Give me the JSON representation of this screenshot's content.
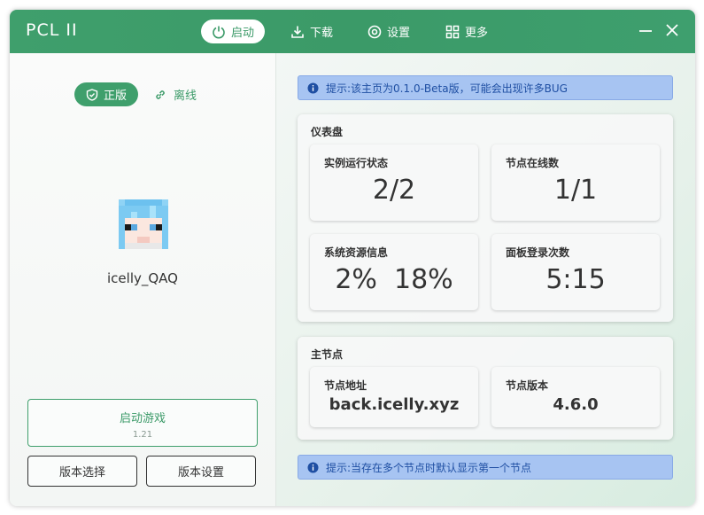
{
  "titlebar": {
    "app_title": "PCL II",
    "nav": [
      {
        "label": "启动",
        "icon": "power-icon",
        "active": true
      },
      {
        "label": "下载",
        "icon": "download-icon",
        "active": false
      },
      {
        "label": "设置",
        "icon": "settings-icon",
        "active": false
      },
      {
        "label": "更多",
        "icon": "grid-icon",
        "active": false
      }
    ],
    "window_controls": [
      "minimize-icon",
      "close-icon"
    ]
  },
  "sidebar": {
    "official_label": "正版",
    "offline_label": "离线",
    "username": "icelly_QAQ",
    "launch_label": "启动游戏",
    "version": "1.21",
    "version_select_label": "版本选择",
    "version_settings_label": "版本设置"
  },
  "main": {
    "hint_top": "提示:该主页为0.1.0-Beta版，可能会出现许多BUG",
    "dashboard": {
      "title": "仪表盘",
      "tiles": [
        {
          "label": "实例运行状态",
          "value": "2/2"
        },
        {
          "label": "节点在线数",
          "value": "1/1"
        },
        {
          "label": "系统资源信息",
          "value": "2%  18%"
        },
        {
          "label": "面板登录次数",
          "value": "5:15"
        }
      ]
    },
    "main_node": {
      "title": "主节点",
      "tiles": [
        {
          "label": "节点地址",
          "value": "back.icelly.xyz"
        },
        {
          "label": "节点版本",
          "value": "4.6.0"
        }
      ]
    },
    "hint_bottom": "提示:当存在多个节点时默认显示第一个节点"
  },
  "colors": {
    "accent": "#3f9f6c",
    "hint_bg": "#a7c4f2",
    "hint_text": "#1f4fa3"
  }
}
